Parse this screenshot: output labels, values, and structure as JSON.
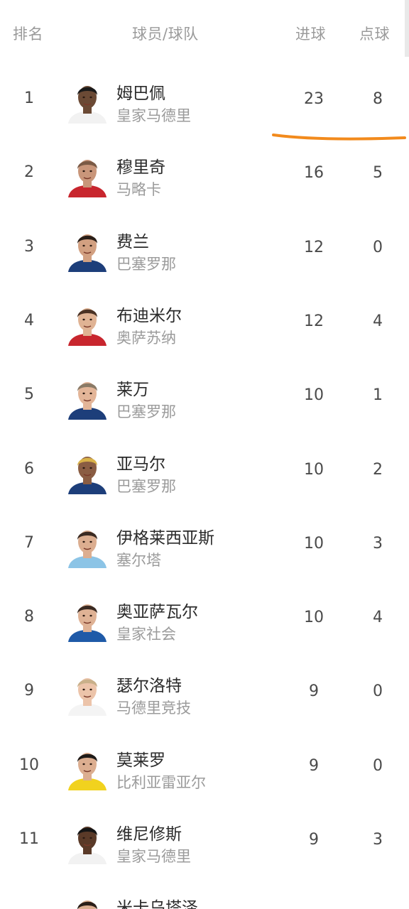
{
  "header": {
    "rank_label": "排名",
    "player_label": "球员/球队",
    "goals_label": "进球",
    "penalties_label": "点球"
  },
  "players": [
    {
      "rank": "1",
      "name": "姆巴佩",
      "team": "皇家马德里",
      "goals": "23",
      "penalties": "8",
      "avatar_skin": "#6b4a35",
      "avatar_hair": "#1a1a1a",
      "avatar_shirt": "#f2f2f2"
    },
    {
      "rank": "2",
      "name": "穆里奇",
      "team": "马略卡",
      "goals": "16",
      "penalties": "5",
      "avatar_skin": "#c9967a",
      "avatar_hair": "#7a5a45",
      "avatar_shirt": "#c8262e"
    },
    {
      "rank": "3",
      "name": "费兰",
      "team": "巴塞罗那",
      "goals": "12",
      "penalties": "0",
      "avatar_skin": "#d2a081",
      "avatar_hair": "#2a1e18",
      "avatar_shirt": "#1d3e7a"
    },
    {
      "rank": "4",
      "name": "布迪米尔",
      "team": "奥萨苏纳",
      "goals": "12",
      "penalties": "4",
      "avatar_skin": "#e0b394",
      "avatar_hair": "#4a3224",
      "avatar_shirt": "#c8262e"
    },
    {
      "rank": "5",
      "name": "莱万",
      "team": "巴塞罗那",
      "goals": "10",
      "penalties": "1",
      "avatar_skin": "#e3b598",
      "avatar_hair": "#8a7a66",
      "avatar_shirt": "#1d3e7a"
    },
    {
      "rank": "6",
      "name": "亚马尔",
      "team": "巴塞罗那",
      "goals": "10",
      "penalties": "2",
      "avatar_skin": "#8a5d43",
      "avatar_hair": "#d9b24a",
      "avatar_shirt": "#1d3e7a"
    },
    {
      "rank": "7",
      "name": "伊格莱西亚斯",
      "team": "塞尔塔",
      "goals": "10",
      "penalties": "3",
      "avatar_skin": "#dcae90",
      "avatar_hair": "#3a2a22",
      "avatar_shirt": "#8cc4e6"
    },
    {
      "rank": "8",
      "name": "奥亚萨瓦尔",
      "team": "皇家社会",
      "goals": "10",
      "penalties": "4",
      "avatar_skin": "#dfb295",
      "avatar_hair": "#3a2a22",
      "avatar_shirt": "#1f5aa8"
    },
    {
      "rank": "9",
      "name": "瑟尔洛特",
      "team": "马德里竞技",
      "goals": "9",
      "penalties": "0",
      "avatar_skin": "#ecc4aa",
      "avatar_hair": "#c9b08a",
      "avatar_shirt": "#f4f4f4"
    },
    {
      "rank": "10",
      "name": "莫莱罗",
      "team": "比利亚雷亚尔",
      "goals": "9",
      "penalties": "0",
      "avatar_skin": "#dcae90",
      "avatar_hair": "#1e1a18",
      "avatar_shirt": "#f1d21e"
    },
    {
      "rank": "11",
      "name": "维尼修斯",
      "team": "皇家马德里",
      "goals": "9",
      "penalties": "3",
      "avatar_skin": "#5a3a28",
      "avatar_hair": "#151515",
      "avatar_shirt": "#f2f2f2"
    },
    {
      "rank": "",
      "name": "米卡乌塔泽",
      "team": "",
      "goals": "",
      "penalties": "",
      "avatar_skin": "#dcae90",
      "avatar_hair": "#2a1e18",
      "avatar_shirt": "#1d3e7a"
    }
  ],
  "colors": {
    "highlight_stroke": "#f28a1c",
    "header_text": "#9a9a9a",
    "team_text": "#9b9b9b"
  }
}
